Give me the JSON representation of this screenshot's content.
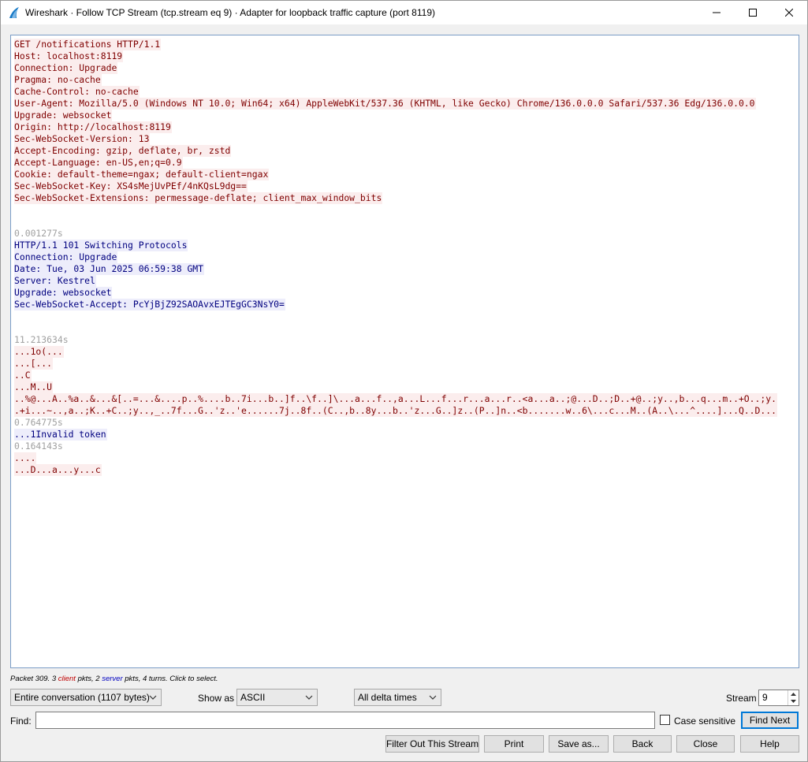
{
  "window": {
    "title": "Wireshark · Follow TCP Stream (tcp.stream eq 9) · Adapter for loopback traffic capture (port 8119)"
  },
  "stream": {
    "lines": [
      {
        "kind": "client",
        "text": "GET /notifications HTTP/1.1"
      },
      {
        "kind": "client",
        "text": "Host: localhost:8119"
      },
      {
        "kind": "client",
        "text": "Connection: Upgrade"
      },
      {
        "kind": "client",
        "text": "Pragma: no-cache"
      },
      {
        "kind": "client",
        "text": "Cache-Control: no-cache"
      },
      {
        "kind": "client",
        "text": "User-Agent: Mozilla/5.0 (Windows NT 10.0; Win64; x64) AppleWebKit/537.36 (KHTML, like Gecko) Chrome/136.0.0.0 Safari/537.36 Edg/136.0.0.0"
      },
      {
        "kind": "client",
        "text": "Upgrade: websocket"
      },
      {
        "kind": "client",
        "text": "Origin: http://localhost:8119"
      },
      {
        "kind": "client",
        "text": "Sec-WebSocket-Version: 13"
      },
      {
        "kind": "client",
        "text": "Accept-Encoding: gzip, deflate, br, zstd"
      },
      {
        "kind": "client",
        "text": "Accept-Language: en-US,en;q=0.9"
      },
      {
        "kind": "client",
        "text": "Cookie: default-theme=ngax; default-client=ngax"
      },
      {
        "kind": "client",
        "text": "Sec-WebSocket-Key: XS4sMejUvPEf/4nKQsL9dg=="
      },
      {
        "kind": "client",
        "text": "Sec-WebSocket-Extensions: permessage-deflate; client_max_window_bits"
      },
      {
        "kind": "blank",
        "text": ""
      },
      {
        "kind": "blank",
        "text": ""
      },
      {
        "kind": "ts",
        "text": "0.001277s"
      },
      {
        "kind": "server",
        "text": "HTTP/1.1 101 Switching Protocols"
      },
      {
        "kind": "server",
        "text": "Connection: Upgrade"
      },
      {
        "kind": "server",
        "text": "Date: Tue, 03 Jun 2025 06:59:38 GMT"
      },
      {
        "kind": "server",
        "text": "Server: Kestrel"
      },
      {
        "kind": "server",
        "text": "Upgrade: websocket"
      },
      {
        "kind": "server",
        "text": "Sec-WebSocket-Accept: PcYjBjZ92SAOAvxEJTEgGC3NsY0="
      },
      {
        "kind": "blank",
        "text": ""
      },
      {
        "kind": "blank",
        "text": ""
      },
      {
        "kind": "ts",
        "text": "11.213634s"
      },
      {
        "kind": "client",
        "text": "...1o(..."
      },
      {
        "kind": "client",
        "text": "...[..."
      },
      {
        "kind": "client",
        "text": "..C"
      },
      {
        "kind": "client",
        "text": "...M..U"
      },
      {
        "kind": "client",
        "text": "..%@...A..%a..&...&[..=...&....p..%....b..7i...b..]f..\\f..]\\...a...f..,a...L...f...r...a...r..<a...a..;@...D..;D..+@..;y..,b...q...m..+O..;y."
      },
      {
        "kind": "client",
        "text": ".+i...~..,a..;K..+C..;y..,_..7f...G..'z..'e......7j..8f..(C..,b..8y...b..'z...G..]z..(P..]n..<b.......w..6\\...c...M..(A..\\...^....]...Q..D..."
      },
      {
        "kind": "ts",
        "text": "0.764775s"
      },
      {
        "kind": "server",
        "text": "...1Invalid token"
      },
      {
        "kind": "ts",
        "text": "0.164143s"
      },
      {
        "kind": "client",
        "text": "...."
      },
      {
        "kind": "client",
        "text": "...D...a...y...c"
      }
    ]
  },
  "status": {
    "packet": "Packet 309.",
    "client_count": "3",
    "client_word": "client",
    "pkts_a": "pkts,",
    "server_count": "2",
    "server_word": "server",
    "tail": "pkts, 4 turns. Click to select."
  },
  "controls": {
    "conversation": "Entire conversation (1107 bytes)",
    "show_as_label": "Show as",
    "show_as_value": "ASCII",
    "delta_value": "All delta times",
    "stream_label": "Stream",
    "stream_value": "9",
    "find_label": "Find:",
    "find_value": "",
    "case_sensitive": "Case sensitive",
    "find_next": "Find Next"
  },
  "buttons": {
    "filter_out": "Filter Out This Stream",
    "print": "Print",
    "save_as": "Save as...",
    "back": "Back",
    "close": "Close",
    "help": "Help"
  },
  "colors": {
    "client_bg": "#fbeded",
    "client_fg": "#7f0000",
    "server_bg": "#ededfb",
    "server_fg": "#00007f",
    "accent": "#0078d7"
  }
}
